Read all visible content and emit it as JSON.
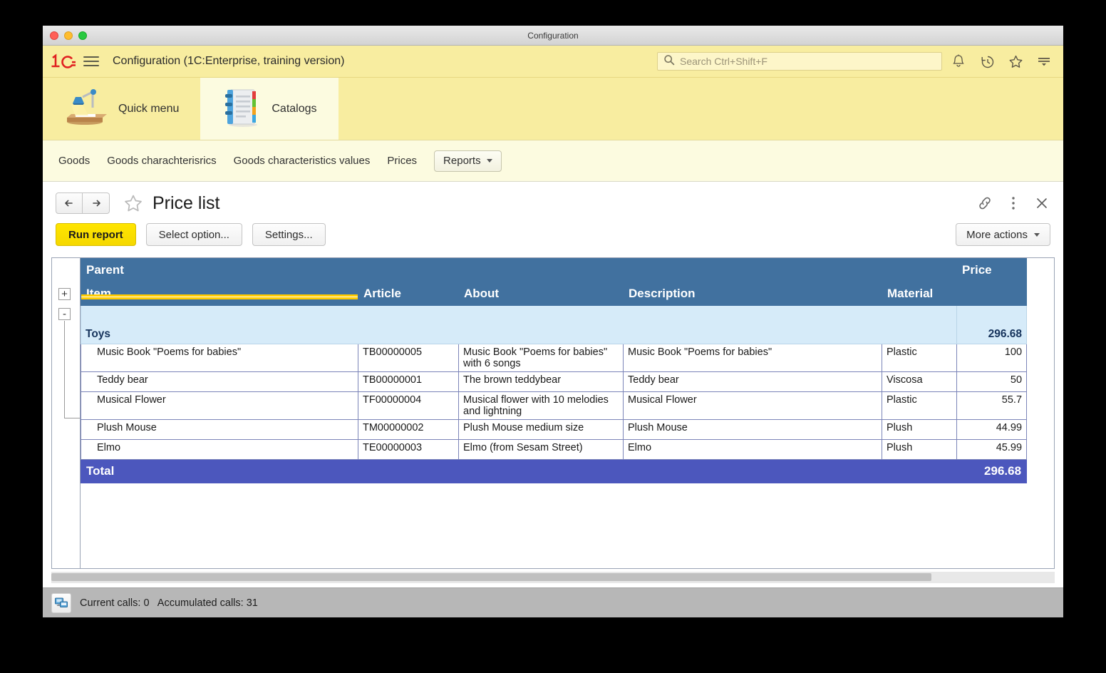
{
  "window": {
    "title": "Configuration"
  },
  "topbar": {
    "logo": "1c-logo-icon",
    "menu_icon": "hamburger-menu-icon",
    "app_title": "Configuration  (1C:Enterprise, training version)",
    "search_placeholder": "Search Ctrl+Shift+F",
    "search_value": "",
    "icons": [
      {
        "name": "notifications-bell-icon"
      },
      {
        "name": "history-clock-icon"
      },
      {
        "name": "favorites-star-icon"
      },
      {
        "name": "menu-lines-icon"
      }
    ]
  },
  "sections": [
    {
      "label": "Quick menu",
      "icon": "desk-lamp-icon",
      "active": false
    },
    {
      "label": "Catalogs",
      "icon": "catalog-notebook-icon",
      "active": true
    }
  ],
  "navbar": {
    "links": [
      "Goods",
      "Goods charachterisrics",
      "Goods characteristics values",
      "Prices"
    ],
    "reports_button": "Reports"
  },
  "form": {
    "back_icon": "arrow-left-icon",
    "forward_icon": "arrow-right-icon",
    "favorite_icon": "star-outline-icon",
    "title": "Price list",
    "link_icon": "link-chain-icon",
    "kebab_icon": "more-vertical-icon",
    "close_icon": "close-x-icon",
    "run_report": "Run report",
    "select_option": "Select option...",
    "settings": "Settings...",
    "more_actions": "More actions"
  },
  "report": {
    "header_top": {
      "parent": "Parent",
      "price": "Price"
    },
    "columns": [
      "Item",
      "Article",
      "About",
      "Description",
      "Material"
    ],
    "price_column": "Price",
    "group_rows": [
      {
        "label": "",
        "price": "",
        "blank": true,
        "expander": "+"
      },
      {
        "label": "Toys",
        "price": "296.68",
        "blank": false,
        "expander": "-"
      }
    ],
    "rows": [
      {
        "item": "Music Book \"Poems for babies\"",
        "article": "TB00000005",
        "about": "Music Book \"Poems for babies\" with 6 songs",
        "description": "Music Book \"Poems for babies\"",
        "material": "Plastic",
        "price": "100"
      },
      {
        "item": "Teddy bear",
        "article": "TB00000001",
        "about": "The brown teddybear",
        "description": "Teddy bear",
        "material": "Viscosa",
        "price": "50"
      },
      {
        "item": "Musical Flower",
        "article": "TF00000004",
        "about": "Musical flower with 10 melodies and lightning",
        "description": "Musical Flower",
        "material": "Plastic",
        "price": "55.7"
      },
      {
        "item": "Plush Mouse",
        "article": "TM00000002",
        "about": "Plush Mouse medium size",
        "description": "Plush Mouse",
        "material": "Plush",
        "price": "44.99"
      },
      {
        "item": "Elmo",
        "article": "TE00000003",
        "about": "Elmo (from Sesam Street)",
        "description": "Elmo",
        "material": "Plush",
        "price": "45.99"
      }
    ],
    "total": {
      "label": "Total",
      "price": "296.68"
    }
  },
  "statusbar": {
    "icon": "network-calls-icon",
    "text": "Current calls: 0   Accumulated calls: 31"
  },
  "colors": {
    "topbar_yellow": "#f8eda0",
    "panel_yellow": "#fcfbe0",
    "header_blue": "#41719F",
    "group_blue": "#D6EBF9",
    "total_blue": "#4C57BD",
    "run_yellow": "#ffe500",
    "logo_red": "#e02020",
    "selection_gold": "#ffcc00"
  }
}
